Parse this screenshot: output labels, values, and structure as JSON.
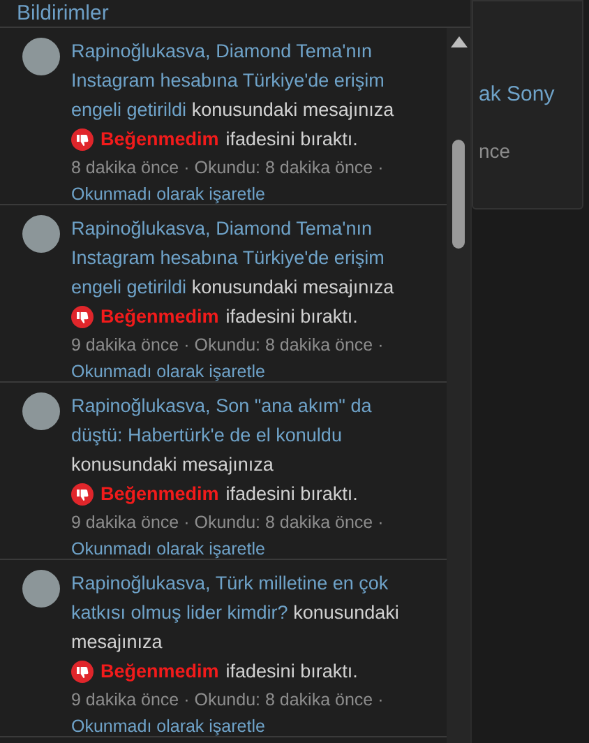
{
  "header": {
    "title": "Bildirimler"
  },
  "background_panel": {
    "link_text": "ak Sony",
    "meta_text": "nce"
  },
  "notifications": [
    {
      "user": "Rapinoğlukasva,",
      "topic": "Diamond Tema'nın Instagram hesabına Türkiye'de erişim engeli getirildi",
      "context": "konusundaki mesajınıza",
      "reaction": {
        "label": "Beğenmedim",
        "suffix": "ifadesini bıraktı."
      },
      "time": "8 dakika önce · Okundu: 8 dakika önce ·",
      "action": "Okunmadı olarak işaretle"
    },
    {
      "user": "Rapinoğlukasva,",
      "topic": "Diamond Tema'nın Instagram hesabına Türkiye'de erişim engeli getirildi",
      "context": "konusundaki mesajınıza",
      "reaction": {
        "label": "Beğenmedim",
        "suffix": "ifadesini bıraktı."
      },
      "time": "9 dakika önce · Okundu: 8 dakika önce ·",
      "action": "Okunmadı olarak işaretle"
    },
    {
      "user": "Rapinoğlukasva,",
      "topic": "Son \"ana akım\" da düştü: Habertürk'e de el konuldu",
      "context": "konusundaki mesajınıza",
      "reaction": {
        "label": "Beğenmedim",
        "suffix": "ifadesini bıraktı."
      },
      "time": "9 dakika önce · Okundu: 8 dakika önce ·",
      "action": "Okunmadı olarak işaretle"
    },
    {
      "user": "Rapinoğlukasva,",
      "topic": "Türk milletine en çok katkısı olmuş lider kimdir?",
      "context": "konusundaki mesajınıza",
      "reaction": {
        "label": "Beğenmedim",
        "suffix": "ifadesini bıraktı."
      },
      "time": "9 dakika önce · Okundu: 8 dakika önce ·",
      "action": "Okunmadı olarak işaretle"
    }
  ]
}
